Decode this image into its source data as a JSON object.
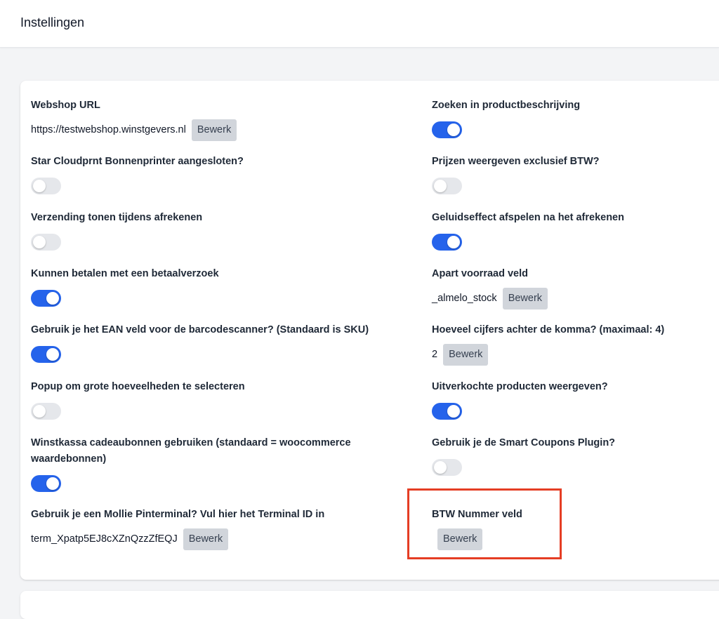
{
  "header": {
    "title": "Instellingen"
  },
  "colors": {
    "accent": "#2563eb",
    "toggle_off": "#e5e7eb",
    "button": "#d1d5db",
    "highlight": "#e53d24"
  },
  "settings": {
    "webshop_url": {
      "label": "Webshop URL",
      "value": "https://testwebshop.winstgevers.nl",
      "button": "Bewerk"
    },
    "search_description": {
      "label": "Zoeken in productbeschrijving",
      "enabled": true
    },
    "star_printer": {
      "label": "Star Cloudprnt Bonnenprinter aangesloten?",
      "enabled": false
    },
    "prices_excl_vat": {
      "label": "Prijzen weergeven exclusief BTW?",
      "enabled": false
    },
    "show_shipping": {
      "label": "Verzending tonen tijdens afrekenen",
      "enabled": false
    },
    "sound_effect": {
      "label": "Geluidseffect afspelen na het afrekenen",
      "enabled": true
    },
    "payment_request": {
      "label": "Kunnen betalen met een betaalverzoek",
      "enabled": true
    },
    "stock_field": {
      "label": "Apart voorraad veld",
      "value": "_almelo_stock",
      "button": "Bewerk"
    },
    "ean_field": {
      "label": "Gebruik je het EAN veld voor de barcodescanner? (Standaard is SKU)",
      "enabled": true
    },
    "decimals": {
      "label": "Hoeveel cijfers achter de komma? (maximaal: 4)",
      "value": "2",
      "button": "Bewerk"
    },
    "popup_quantities": {
      "label": "Popup om grote hoeveelheden te selecteren",
      "enabled": false
    },
    "sold_out": {
      "label": "Uitverkochte producten weergeven?",
      "enabled": true
    },
    "gift_cards": {
      "label": "Winstkassa cadeaubonnen gebruiken (standaard = woocommerce waardebonnen)",
      "enabled": true
    },
    "smart_coupons": {
      "label": "Gebruik je de Smart Coupons Plugin?",
      "enabled": false
    },
    "mollie_terminal": {
      "label": "Gebruik je een Mollie Pinterminal? Vul hier het Terminal ID in",
      "value": "term_Xpatp5EJ8cXZnQzzZfEQJ",
      "button": "Bewerk"
    },
    "vat_number_field": {
      "label": "BTW Nummer veld",
      "value": "",
      "button": "Bewerk"
    }
  }
}
